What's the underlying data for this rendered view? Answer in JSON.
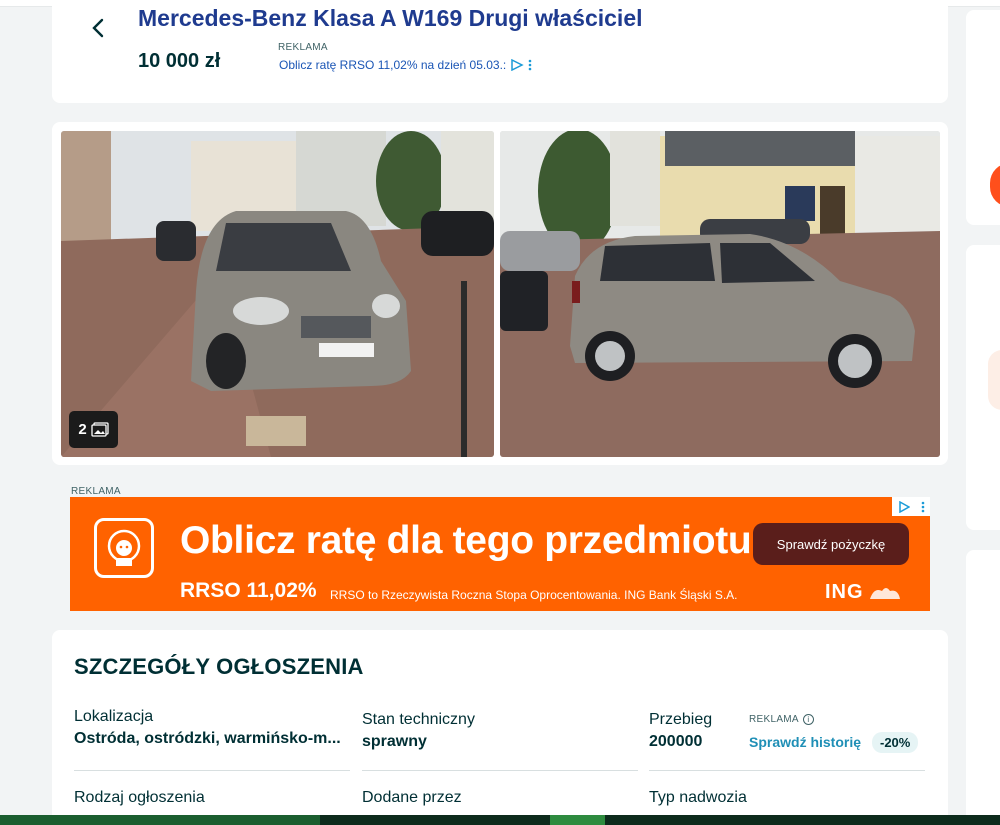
{
  "header": {
    "title": "Mercedes-Benz Klasa A W169 Drugi właściciel",
    "price": "10 000 zł",
    "ad_label": "REKLAMA",
    "ad_text": "Oblicz ratę RRSO 11,02% na dzień 05.03.:"
  },
  "gallery": {
    "photo_count": "2"
  },
  "banner": {
    "label": "REKLAMA",
    "headline": "Oblicz ratę dla tego przedmiotu",
    "button": "Sprawdź pożyczkę",
    "rrso": "RRSO 11,02%",
    "fine_print": "RRSO to Rzeczywista Roczna Stopa Oprocentowania. ING Bank Śląski S.A.",
    "brand": "ING"
  },
  "details": {
    "heading": "SZCZEGÓŁY OGŁOSZENIA",
    "fields": [
      {
        "label": "Lokalizacja",
        "value": "Ostróda, ostródzki, warmińsko-m..."
      },
      {
        "label": "Stan techniczny",
        "value": "sprawny"
      },
      {
        "label": "Przebieg",
        "value": "200000"
      },
      {
        "label": "Rodzaj ogłoszenia",
        "value": ""
      },
      {
        "label": "Dodane przez",
        "value": ""
      },
      {
        "label": "Typ nadwozia",
        "value": ""
      }
    ],
    "ad_label": "REKLAMA",
    "history_link": "Sprawdź historię",
    "discount": "-20%"
  },
  "colors": {
    "title_blue": "#1f3b8f",
    "banner_orange": "#ff6200",
    "link_teal": "#1f8fb6"
  }
}
